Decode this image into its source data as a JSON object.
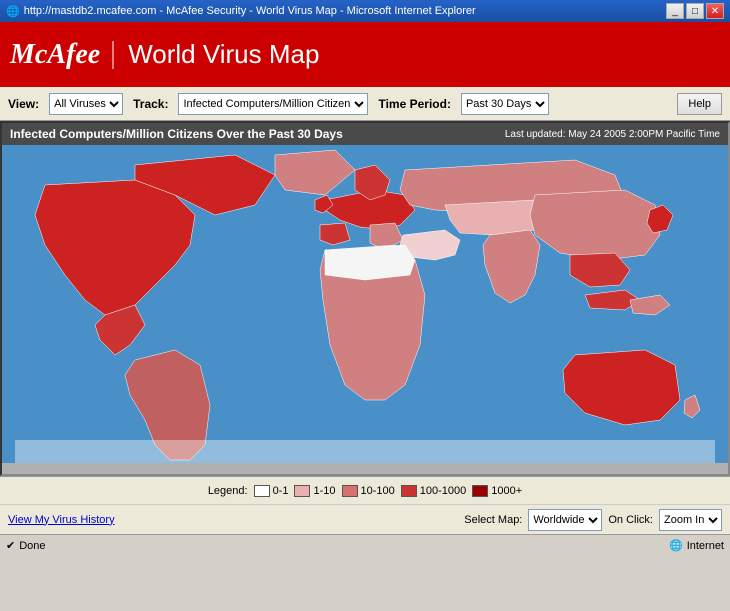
{
  "titlebar": {
    "text": "http://mastdb2.mcafee.com - McAfee Security - World Virus Map - Microsoft Internet Explorer"
  },
  "header": {
    "logo": "McAfee",
    "title": "World Virus Map"
  },
  "controls": {
    "view_label": "View:",
    "view_value": "All Viruses",
    "track_label": "Track:",
    "track_value": "Infected Computers/Million Citizens",
    "time_period_label": "Time Period:",
    "time_period_value": "Past 30 Days",
    "help_label": "Help"
  },
  "map_header": {
    "title": "Infected Computers/Million Citizens Over the Past 30 Days",
    "updated": "Last updated: May 24 2005 2:00PM Pacific Time"
  },
  "legend": {
    "label": "Legend:",
    "items": [
      {
        "range": "0-1",
        "color": "#ffffff"
      },
      {
        "range": "1-10",
        "color": "#e8b0b0"
      },
      {
        "range": "10-100",
        "color": "#d87070"
      },
      {
        "range": "100-1000",
        "color": "#cc3333"
      },
      {
        "range": "1000+",
        "color": "#990000"
      }
    ]
  },
  "bottom": {
    "view_history": "View My Virus History",
    "select_map_label": "Select Map:",
    "select_map_value": "Worldwide",
    "on_click_label": "On Click:",
    "on_click_value": "Zoom In"
  },
  "statusbar": {
    "status": "Done",
    "zone": "Internet"
  }
}
